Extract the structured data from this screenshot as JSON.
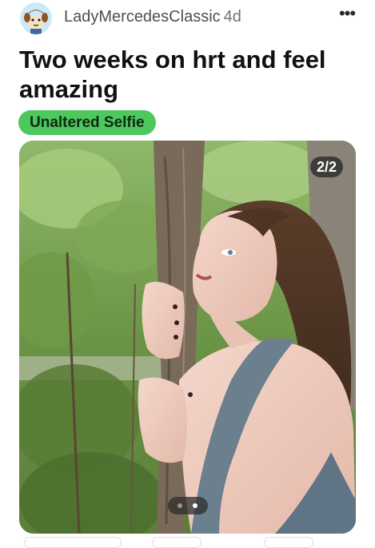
{
  "post": {
    "username": "LadyMercedesClassic",
    "age": "4d",
    "more_label": "•••",
    "title": "Two weeks on hrt and feel amazing",
    "flair": "Unaltered Selfie"
  },
  "media": {
    "counter": "2/2",
    "current_index": 2,
    "total": 2
  },
  "icons": {
    "avatar": "avatar-icon",
    "more": "more-options-icon"
  },
  "colors": {
    "flair_bg": "#4cc85c",
    "counter_bg": "#2b2b2b"
  }
}
